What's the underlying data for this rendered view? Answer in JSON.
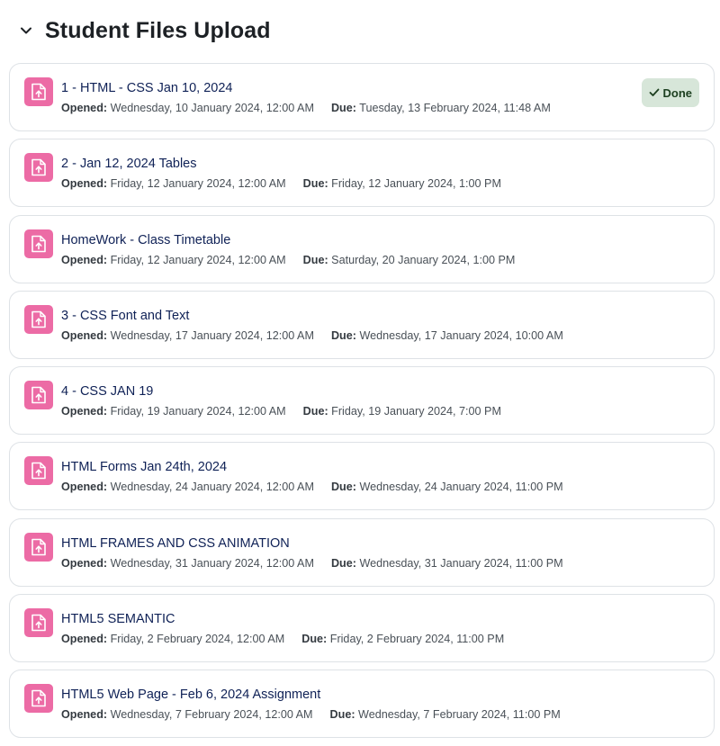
{
  "section": {
    "title": "Student Files Upload",
    "toggle_icon": "chevron-down-icon"
  },
  "labels": {
    "opened": "Opened:",
    "due": "Due:"
  },
  "colors": {
    "icon_bg": "#ec6ba5",
    "link": "#0f2156",
    "done_bg": "#d7e6d9",
    "done_text": "#1c3f1f"
  },
  "activities": [
    {
      "name": "1 - HTML - CSS Jan 10, 2024",
      "opened": "Wednesday, 10 January 2024, 12:00 AM",
      "due": "Tuesday, 13 February 2024, 11:48 AM",
      "status": "Done",
      "icon": "assignment-upload-icon"
    },
    {
      "name": "2 - Jan 12, 2024 Tables",
      "opened": "Friday, 12 January 2024, 12:00 AM",
      "due": "Friday, 12 January 2024, 1:00 PM",
      "icon": "assignment-upload-icon"
    },
    {
      "name": "HomeWork - Class Timetable",
      "opened": "Friday, 12 January 2024, 12:00 AM",
      "due": "Saturday, 20 January 2024, 1:00 PM",
      "icon": "assignment-upload-icon"
    },
    {
      "name": "3 - CSS Font and Text",
      "opened": "Wednesday, 17 January 2024, 12:00 AM",
      "due": "Wednesday, 17 January 2024, 10:00 AM",
      "icon": "assignment-upload-icon"
    },
    {
      "name": "4 - CSS JAN 19",
      "opened": "Friday, 19 January 2024, 12:00 AM",
      "due": "Friday, 19 January 2024, 7:00 PM",
      "icon": "assignment-upload-icon"
    },
    {
      "name": "HTML Forms Jan 24th, 2024",
      "opened": "Wednesday, 24 January 2024, 12:00 AM",
      "due": "Wednesday, 24 January 2024, 11:00 PM",
      "icon": "assignment-upload-icon"
    },
    {
      "name": "HTML FRAMES AND CSS ANIMATION",
      "opened": "Wednesday, 31 January 2024, 12:00 AM",
      "due": "Wednesday, 31 January 2024, 11:00 PM",
      "icon": "assignment-upload-icon"
    },
    {
      "name": "HTML5 SEMANTIC",
      "opened": "Friday, 2 February 2024, 12:00 AM",
      "due": "Friday, 2 February 2024, 11:00 PM",
      "icon": "assignment-upload-icon"
    },
    {
      "name": "HTML5 Web Page - Feb 6, 2024 Assignment",
      "opened": "Wednesday, 7 February 2024, 12:00 AM",
      "due": "Wednesday, 7 February 2024, 11:00 PM",
      "icon": "assignment-upload-icon"
    }
  ]
}
